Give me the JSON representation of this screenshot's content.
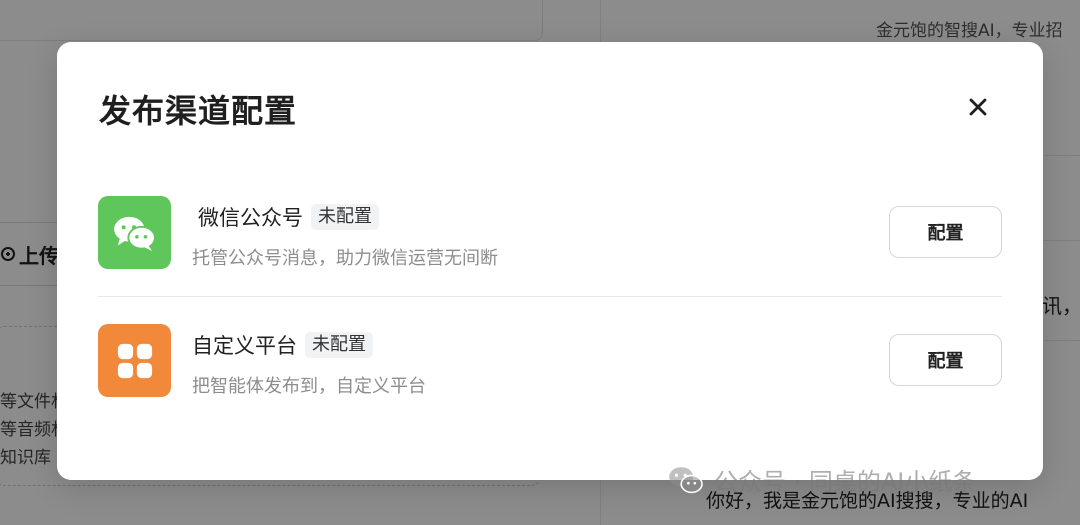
{
  "background": {
    "upload_label": "上传",
    "list_items": [
      "等文件林",
      "等音频林",
      "知识库"
    ],
    "right_top_text": "金元饱的智搜AI，专业招",
    "right_mid_text": "讯，",
    "right_bottom_text": "你好，我是金元饱的AI搜搜，专业的AI"
  },
  "modal": {
    "title": "发布渠道配置",
    "close_icon": "close-icon",
    "channels": [
      {
        "icon": "wechat-icon",
        "color": "#5fc65b",
        "name": "微信公众号",
        "status": "未配置",
        "description": "托管公众号消息，助力微信运营无间断",
        "button_label": "配置"
      },
      {
        "icon": "grid-apps-icon",
        "color": "#f2893a",
        "name": "自定义平台",
        "status": "未配置",
        "description": "把智能体发布到，自定义平台",
        "button_label": "配置"
      }
    ]
  },
  "watermark": {
    "text": "公众号 · 同桌的AI小纸条"
  }
}
